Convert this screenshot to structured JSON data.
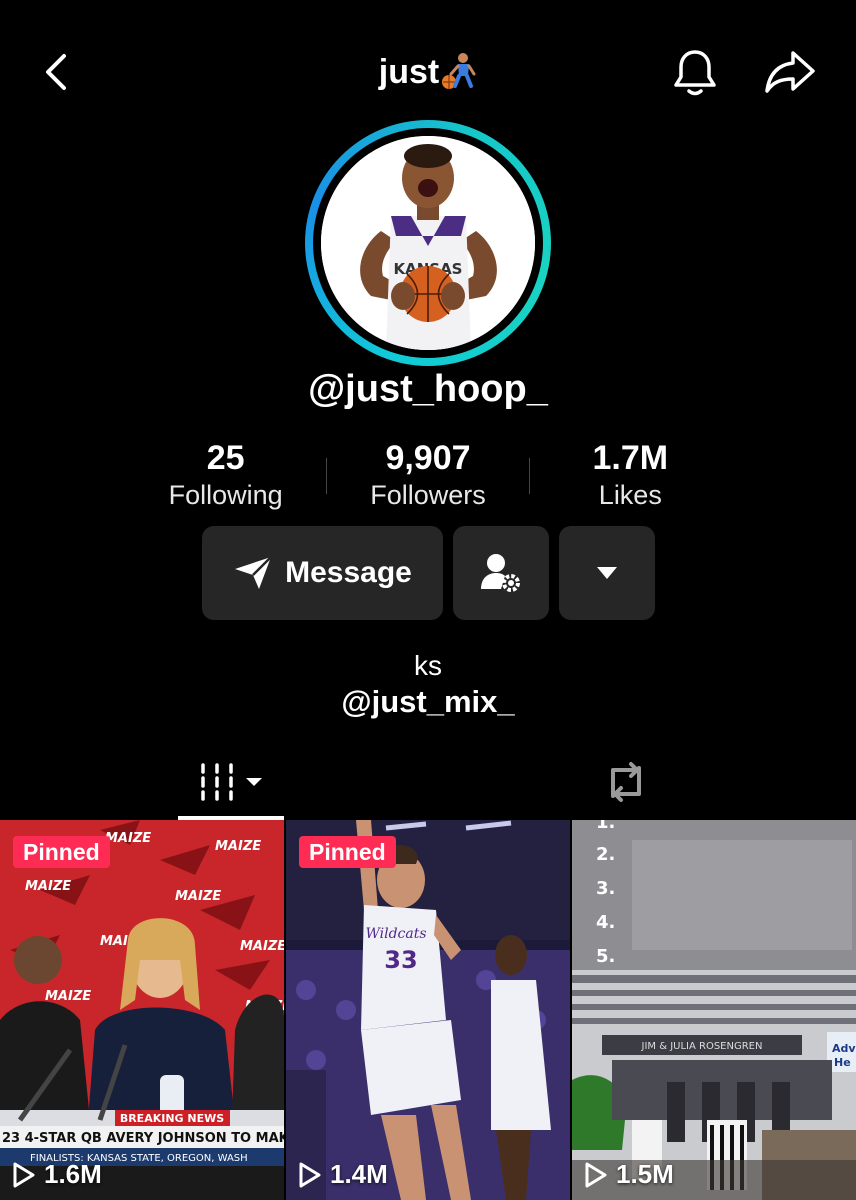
{
  "header": {
    "title": "just",
    "title_emoji": "basketball-player-emoji",
    "back_icon": "chevron-left-icon",
    "bell_icon": "bell-icon",
    "share_icon": "share-arrow-icon"
  },
  "profile": {
    "handle": "@just_hoop_",
    "ring_color": "#16c7d8",
    "stats": [
      {
        "value": "25",
        "label": "Following"
      },
      {
        "value": "9,907",
        "label": "Followers"
      },
      {
        "value": "1.7M",
        "label": "Likes"
      }
    ],
    "actions": {
      "message_label": "Message",
      "message_icon": "send-icon",
      "follow_settings_icon": "user-settings-icon",
      "more_icon": "caret-down-icon"
    },
    "bio": "ks",
    "bio_link": "@just_mix_"
  },
  "tabs": {
    "videos_icon": "grid-bars-icon",
    "reposts_icon": "repost-icon"
  },
  "videos": [
    {
      "pinned": "Pinned",
      "views": "1.6M"
    },
    {
      "pinned": "Pinned",
      "views": "1.4M"
    },
    {
      "pinned": "",
      "views": "1.5M"
    }
  ],
  "colors": {
    "background": "#000000",
    "button_bg": "#262626",
    "pinned_badge": "#fe2c55"
  }
}
